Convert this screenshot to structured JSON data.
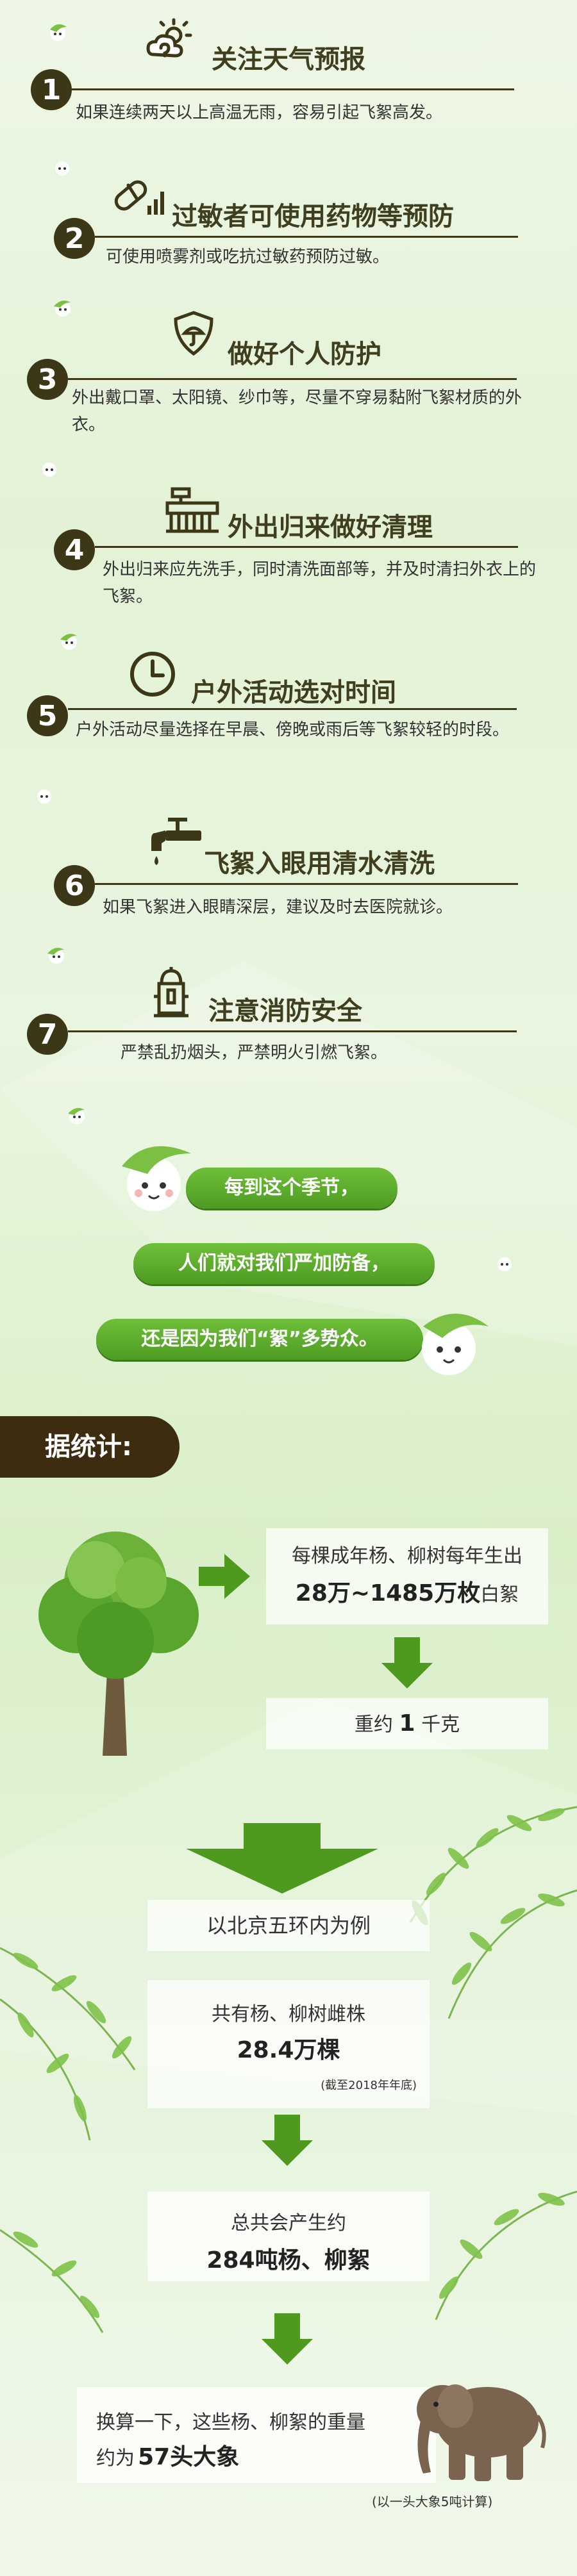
{
  "tips": [
    {
      "num": "1",
      "title": "关注天气预报",
      "desc": "如果连续两天以上高温无雨，容易引起飞絮高发。",
      "icon": "weather-icon"
    },
    {
      "num": "2",
      "title": "过敏者可使用药物等预防",
      "desc": "可使用喷雾剂或吃抗过敏药预防过敏。",
      "icon": "medicine-icon"
    },
    {
      "num": "3",
      "title": "做好个人防护",
      "desc": "外出戴口罩、太阳镜、纱巾等，尽量不穿易黏附飞絮材质的外衣。",
      "icon": "shield-icon"
    },
    {
      "num": "4",
      "title": "外出归来做好清理",
      "desc": "外出归来应先洗手，同时清洗面部等，并及时清扫外衣上的飞絮。",
      "icon": "brush-icon"
    },
    {
      "num": "5",
      "title": "户外活动选对时间",
      "desc": "户外活动尽量选择在早晨、傍晚或雨后等飞絮较轻的时段。",
      "icon": "clock-icon"
    },
    {
      "num": "6",
      "title": "飞絮入眼用清水清洗",
      "desc": "如果飞絮进入眼睛深层，建议及时去医院就诊。",
      "icon": "faucet-icon"
    },
    {
      "num": "7",
      "title": "注意消防安全",
      "desc": "严禁乱扔烟头，严禁明火引燃飞絮。",
      "icon": "hydrant-icon"
    }
  ],
  "bubbles": [
    "每到这个季节，",
    "人们就对我们严加防备，",
    "还是因为我们“絮”多势众。"
  ],
  "stats": {
    "section_title": "据统计:",
    "per_tree_line1": "每棵成年杨、柳树每年生出",
    "per_tree_value": "28万~1485万枚",
    "per_tree_unit": "白絮",
    "weight_prefix": "重约",
    "weight_value": "1",
    "weight_unit": "千克",
    "example": "以北京五环内为例",
    "trees_line": "共有杨、柳树雌株",
    "trees_value": "28.4万棵",
    "trees_note": "(截至2018年年底)",
    "total_line": "总共会产生约",
    "total_value": "284吨杨、柳絮",
    "convert_line1": "换算一下，这些杨、柳絮的重量",
    "convert_prefix": "约为",
    "convert_value": "57头大象",
    "elephant_note": "(以一头大象5吨计算)"
  }
}
